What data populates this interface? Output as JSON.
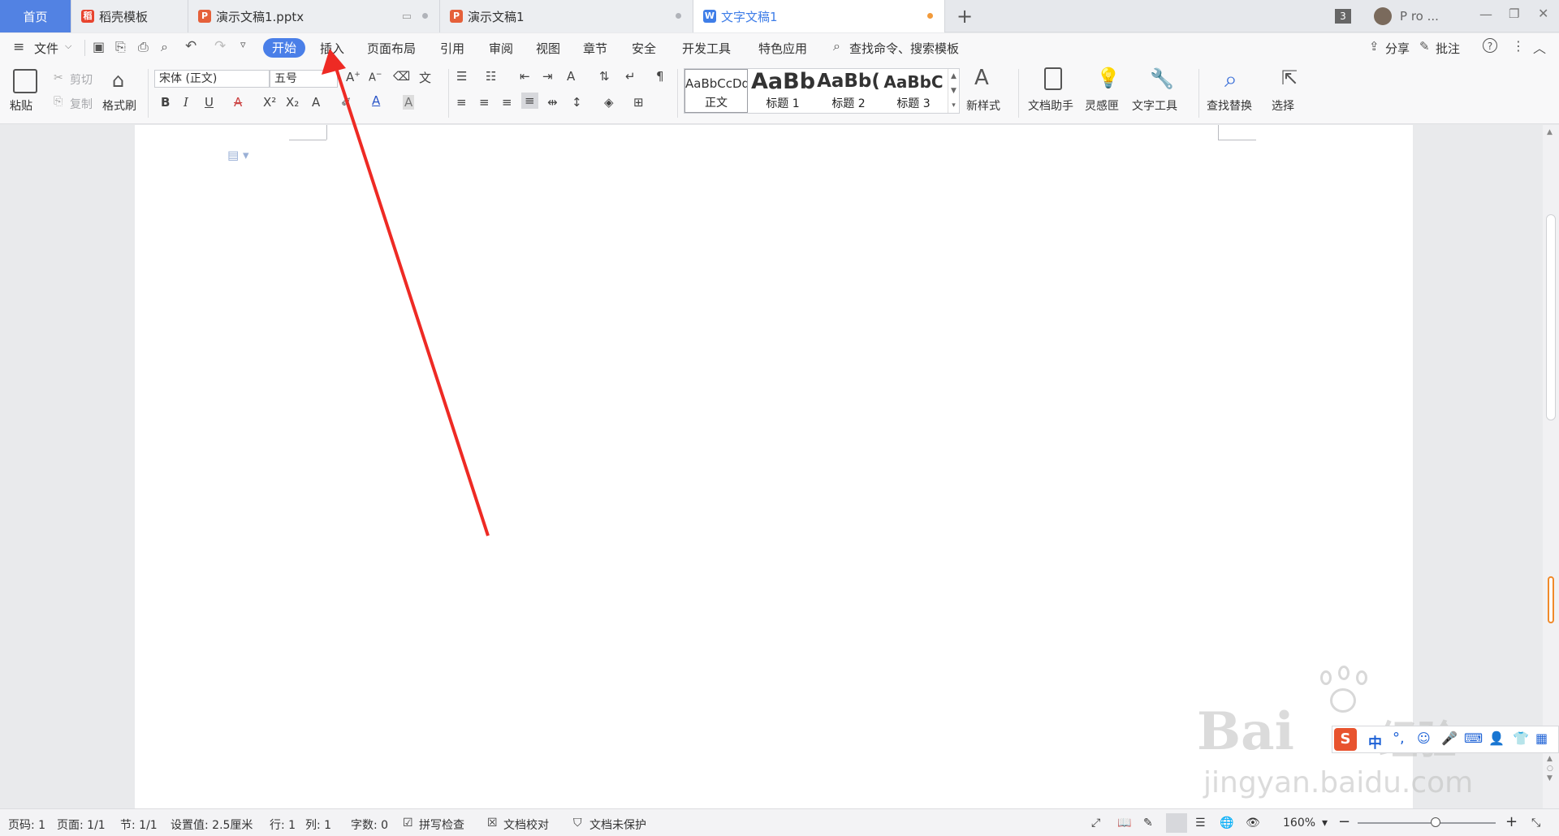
{
  "tabs": {
    "home": "首页",
    "daoke": "稻壳模板",
    "ppt1": "演示文稿1.pptx",
    "ppt2": "演示文稿1",
    "doc": "文字文稿1",
    "add": "+"
  },
  "window": {
    "badge": "3",
    "user": "P ro ..."
  },
  "menu": {
    "file": "文件",
    "start": "开始",
    "insert": "插入",
    "layout": "页面布局",
    "reference": "引用",
    "review": "审阅",
    "view": "视图",
    "chapter": "章节",
    "security": "安全",
    "devtools": "开发工具",
    "special": "特色应用",
    "search": "查找命令、搜索模板",
    "share": "分享",
    "comment": "批注"
  },
  "ribbon": {
    "paste": "粘贴",
    "cut": "剪切",
    "copy": "复制",
    "format_painter": "格式刷",
    "font_name": "宋体 (正文)",
    "font_size": "五号",
    "styles": [
      {
        "preview": "AaBbCcDd",
        "name": "正文"
      },
      {
        "preview": "AaBb",
        "name": "标题 1"
      },
      {
        "preview": "AaBb(",
        "name": "标题 2"
      },
      {
        "preview": "AaBbC",
        "name": "标题 3"
      }
    ],
    "new_style": "新样式",
    "doc_helper": "文档助手",
    "inspiration": "灵感匣",
    "text_tools": "文字工具",
    "find_replace": "查找替换",
    "select": "选择"
  },
  "status": {
    "page_code": "页码: 1",
    "page": "页面: 1/1",
    "section": "节: 1/1",
    "setting": "设置值: 2.5厘米",
    "row": "行: 1",
    "col": "列: 1",
    "word_count": "字数: 0",
    "spell": "拼写检查",
    "proof": "文档校对",
    "protect": "文档未保护",
    "zoom": "160%"
  },
  "watermark": {
    "brand": "Bai",
    "brand2": "经验",
    "url": "jingyan.baidu.com"
  },
  "ime": {
    "lang": "中"
  },
  "colors": {
    "accent": "#4a7fe8",
    "home_tab": "#5282e3",
    "arrow": "#ee2a24",
    "font_color": "#2a55c8"
  }
}
